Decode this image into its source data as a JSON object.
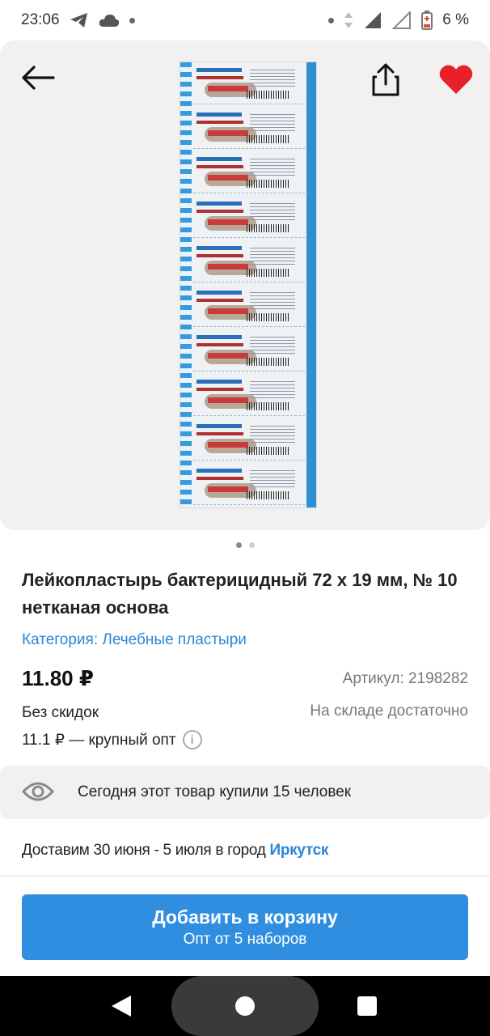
{
  "status_bar": {
    "time": "23:06",
    "battery": "6 %"
  },
  "product": {
    "title": "Лейкопластырь бактерицидный 72 х 19 мм, № 10 нетканая основа",
    "category": "Категория: Лечебные пластыри",
    "price": "11.80 ₽",
    "article": "Артикул: 2198282",
    "discount": "Без скидок",
    "stock": "На складе достаточно",
    "wholesale": "11.1 ₽ — крупный опт",
    "info_icon_glyph": "i",
    "gallery_pages": 2,
    "gallery_current": 1
  },
  "viewed": {
    "text": "Сегодня этот товар купили 15 человек"
  },
  "delivery": {
    "text": "Доставим 30 июня - 5 июля в город ",
    "city": "Иркутск"
  },
  "cart_button": {
    "label": "Добавить в корзину",
    "sublabel": "Опт от 5 наборов"
  },
  "colors": {
    "accent": "#2f8ee0",
    "link": "#2b86d6",
    "favorite": "#e8202a"
  }
}
